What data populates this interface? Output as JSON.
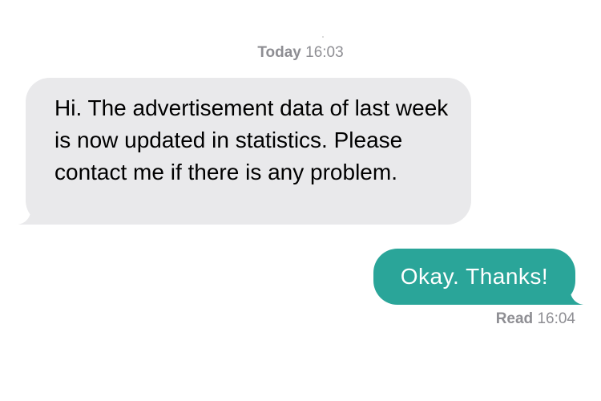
{
  "header": {
    "date_label": "Today",
    "time": "16:03"
  },
  "messages": [
    {
      "direction": "incoming",
      "text": "Hi. The advertisement data of last week is now updated in statistics. Please contact me if there is any problem."
    },
    {
      "direction": "outgoing",
      "text": "Okay. Thanks!"
    }
  ],
  "receipt": {
    "status": "Read",
    "time": "16:04"
  },
  "colors": {
    "incoming_bubble": "#e9e9eb",
    "outgoing_bubble": "#2aa599",
    "meta_text": "#8e8e93"
  }
}
